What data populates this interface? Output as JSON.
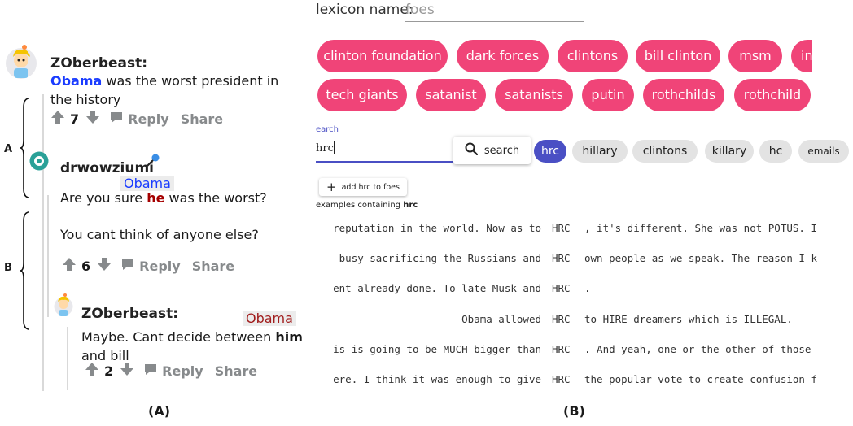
{
  "panel_a": {
    "caption": "(A)",
    "bracket_a": "A",
    "bracket_b": "B",
    "comment1": {
      "username": "ZOberbeast:",
      "text_bold": "Obama",
      "text_rest": " was the worst president in the history",
      "votes": "7",
      "reply": "Reply",
      "share": "Share"
    },
    "comment2": {
      "username": "drwowziumi",
      "annotation": "Obama",
      "text_pre": "Are you sure ",
      "text_bold": "he",
      "text_post": " was the worst?",
      "text2": "You cant think of anyone else?",
      "votes": "6",
      "reply": "Reply",
      "share": "Share"
    },
    "comment3": {
      "username": "ZOberbeast:",
      "annotation": "Obama",
      "text_pre": "Maybe. Cant decide between ",
      "text_bold": "him",
      "text_post": " and bill",
      "votes": "2",
      "reply": "Reply",
      "share": "Share"
    }
  },
  "panel_b": {
    "caption": "(B)",
    "lexicon_label": "lexicon name:",
    "lexicon_value": "foes",
    "lexicon_chips_row1": [
      "clinton foundation",
      "dark forces",
      "clintons",
      "bill clinton",
      "msm",
      "in"
    ],
    "lexicon_chips_row2": [
      "tech giants",
      "satanist",
      "satanists",
      "putin",
      "rothchilds",
      "rothchild"
    ],
    "search_label": "earch",
    "search_value": "hrc",
    "search_button": "search",
    "suggestions": [
      "hrc",
      "hillary",
      "clintons",
      "killary",
      "hc",
      "emails"
    ],
    "add_button": "add hrc to foes",
    "examples_label": "examples containing ",
    "examples_term": "hrc",
    "kwic_rows": [
      {
        "left": "reputation in the world. Now as to",
        "key": "HRC",
        "right": ", it's different. She was not POTUS. I"
      },
      {
        "left": "busy sacrificing the Russians and",
        "key": "HRC",
        "right": "own people as we speak. The reason I k"
      },
      {
        "left": "ent already done. To late Musk and",
        "key": "HRC",
        "right": "."
      },
      {
        "left": "Obama allowed",
        "key": "HRC",
        "right": "to HIRE dreamers which is ILLEGAL."
      },
      {
        "left": "is is going to be MUCH bigger than",
        "key": "HRC",
        "right": ". And yeah, one or the other of those"
      },
      {
        "left": "ere. I think it was enough to give",
        "key": "HRC",
        "right": "the popular vote to create confusion f"
      }
    ]
  },
  "colors": {
    "chip_pink": "#f04478",
    "chip_selected": "#4a4fc4",
    "obama_blue": "#1a3cff",
    "he_red": "#a50000",
    "annotation_red": "#a11d1d"
  }
}
